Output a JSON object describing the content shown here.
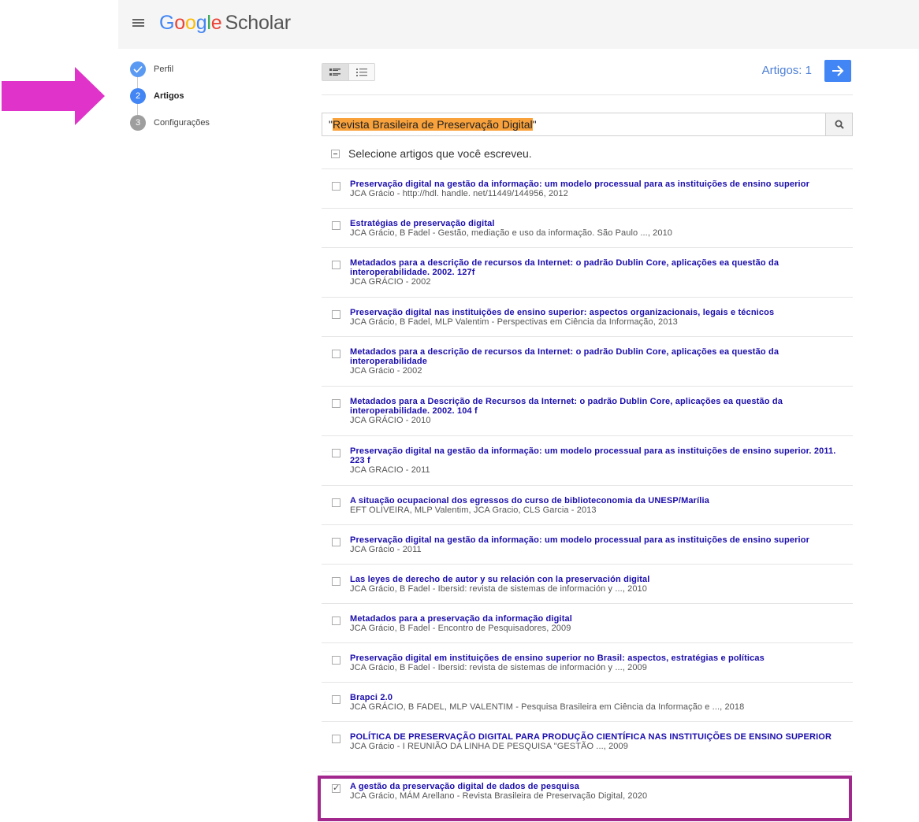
{
  "header": {
    "logo_google": [
      "G",
      "o",
      "o",
      "g",
      "l",
      "e"
    ],
    "logo_scholar": "Scholar"
  },
  "steps": [
    {
      "number": "",
      "label": "Perfil",
      "state": "done"
    },
    {
      "number": "2",
      "label": "Artigos",
      "state": "active"
    },
    {
      "number": "3",
      "label": "Configurações",
      "state": "todo"
    }
  ],
  "toolbar": {
    "articles_count": "Artigos: 1"
  },
  "search": {
    "quote_open": "\"",
    "query": "Revista Brasileira de Preservação Digital",
    "quote_close": "\""
  },
  "select_all_label": "Selecione artigos que você escreveu.",
  "articles": [
    {
      "title": "Preservação digital na gestão da informação: um modelo processual para as instituições de ensino superior",
      "meta": "JCA Grácio - http://hdl. handle. net/11449/144956, 2012",
      "checked": false
    },
    {
      "title": "Estratégias de preservação digital",
      "meta": "JCA Grácio, B Fadel - Gestão, mediação e uso da informação. São Paulo ..., 2010",
      "checked": false
    },
    {
      "title": "Metadados para a descrição de recursos da Internet: o padrão Dublin Core, aplicações ea questão da interoperabilidade. 2002. 127f",
      "meta": "JCA GRÁCIO - 2002",
      "checked": false
    },
    {
      "title": "Preservação digital nas instituições de ensino superior: aspectos organizacionais, legais e técnicos",
      "meta": "JCA Grácio, B Fadel, MLP Valentim - Perspectivas em Ciência da Informação, 2013",
      "checked": false
    },
    {
      "title": "Metadados para a descrição de recursos da Internet: o padrão Dublin Core, aplicações ea questão da interoperabilidade",
      "meta": "JCA Grácio - 2002",
      "checked": false
    },
    {
      "title": "Metadados para a Descrição de Recursos da Internet: o padrão Dublin Core, aplicações ea questão da interoperabilidade. 2002. 104 f",
      "meta": "JCA GRÁCIO - 2010",
      "checked": false
    },
    {
      "title": "Preservação digital na gestão da informação: um modelo processual para as instituições de ensino superior. 2011. 223 f",
      "meta": "JCA GRACIO - 2011",
      "checked": false
    },
    {
      "title": "A situação ocupacional dos egressos do curso de biblioteconomia da UNESP/Marília",
      "meta": "EFT OLIVEIRA, MLP Valentim, JCA Gracio, CLS Garcia - 2013",
      "checked": false
    },
    {
      "title": "Preservação digital na gestão da informação: um modelo processual para as instituições de ensino superior",
      "meta": "JCA Grácio - 2011",
      "checked": false
    },
    {
      "title": "Las leyes de derecho de autor y su relación con la preservación digital",
      "meta": "JCA Grácio, B Fadel - Ibersid: revista de sistemas de información y ..., 2010",
      "checked": false
    },
    {
      "title": "Metadados para a preservação da informação digital",
      "meta": "JCA Grácio, B Fadel - Encontro de Pesquisadores, 2009",
      "checked": false
    },
    {
      "title": "Preservação digital em instituições de ensino superior no Brasil: aspectos, estratégias e políticas",
      "meta": "JCA Grácio, B Fadel - Ibersid: revista de sistemas de información y ..., 2009",
      "checked": false
    },
    {
      "title": "Brapci 2.0",
      "meta": "JCA GRÁCIO, B FADEL, MLP VALENTIM - Pesquisa Brasileira em Ciência da Informação e ..., 2018",
      "checked": false
    },
    {
      "title": "POLÍTICA DE PRESERVAÇÃO DIGITAL PARA PRODUÇÃO CIENTÍFICA NAS INSTITUIÇÕES DE ENSINO SUPERIOR",
      "meta": "JCA Grácio - I REUNIÃO DA LINHA DE PESQUISA \"GESTÃO ..., 2009",
      "checked": false
    },
    {
      "title": "A gestão da preservação digital de dados de pesquisa",
      "meta": "JCA Grácio, MÁM Arellano - Revista Brasileira de Preservação Digital, 2020",
      "checked": true
    }
  ],
  "colors": {
    "accent": "#4285f4",
    "link": "#1a0dab",
    "highlight": "#f9a23c",
    "annotation_arrow": "#e033c9",
    "annotation_box": "#a2288d"
  }
}
